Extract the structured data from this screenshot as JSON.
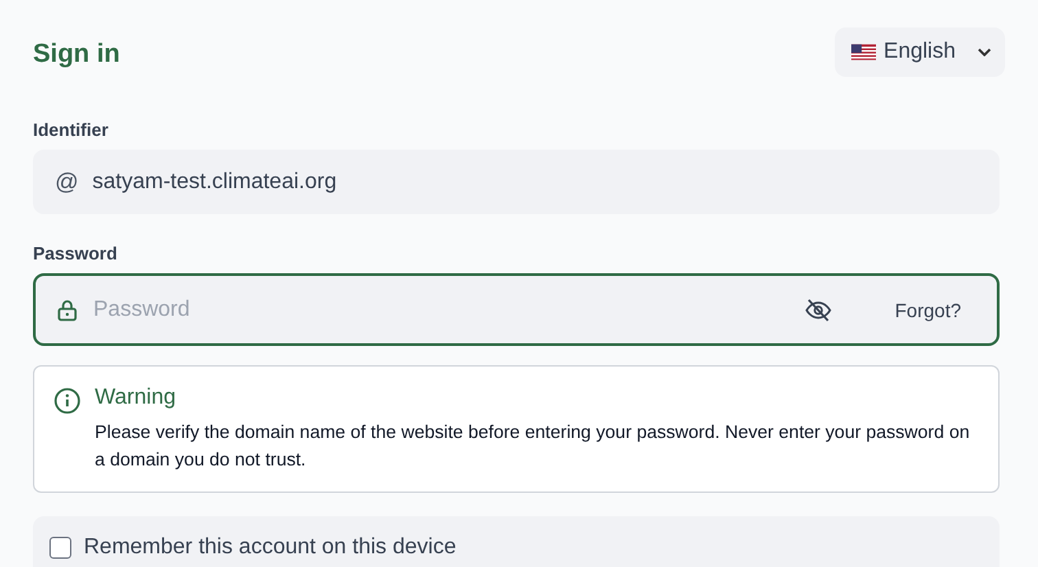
{
  "title": "Sign in",
  "language": {
    "value": "English"
  },
  "identifier": {
    "label": "Identifier",
    "prefix": "@",
    "value": "satyam-test.climateai.org"
  },
  "password": {
    "label": "Password",
    "placeholder": "Password",
    "focused": true,
    "forgot": "Forgot?"
  },
  "warning": {
    "title": "Warning",
    "text": "Please verify the domain name of the website before entering your password. Never enter your password on a domain you do not trust."
  },
  "remember": {
    "label": "Remember this account on this device",
    "checked": false
  }
}
